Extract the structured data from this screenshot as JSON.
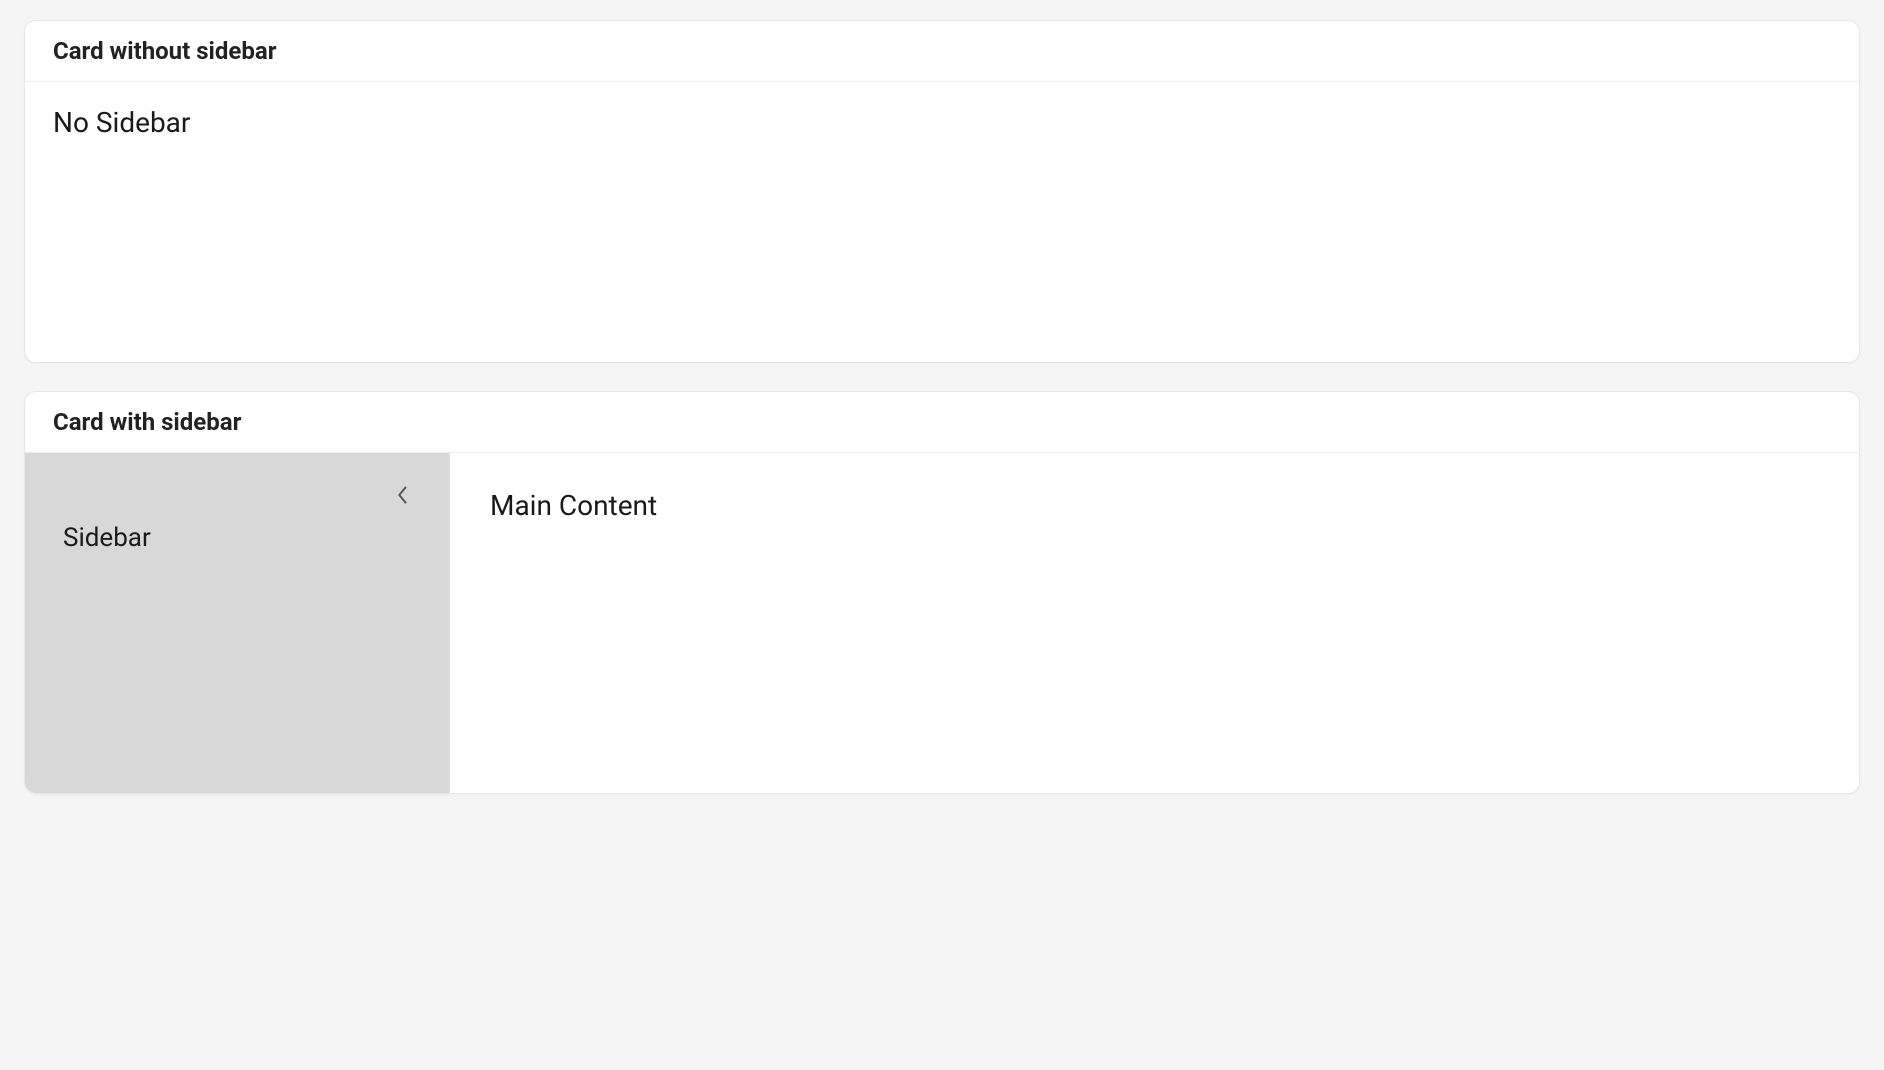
{
  "cards": [
    {
      "header_title": "Card without sidebar",
      "body_text": "No Sidebar"
    },
    {
      "header_title": "Card with sidebar",
      "sidebar_text": "Sidebar",
      "main_text": "Main Content"
    }
  ]
}
